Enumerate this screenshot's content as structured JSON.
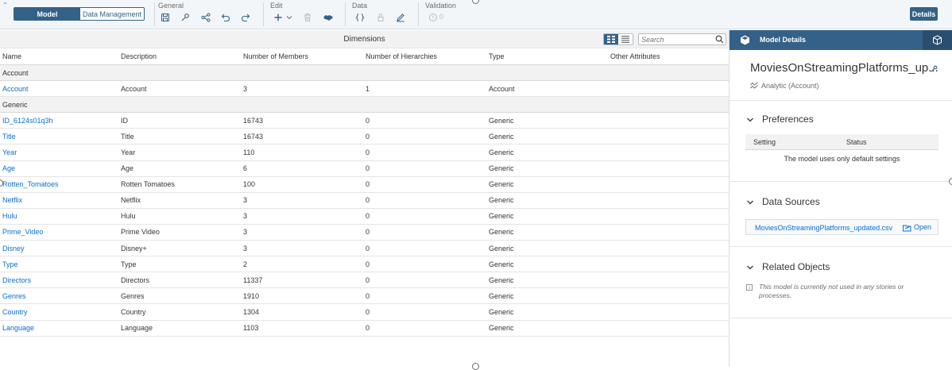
{
  "toolbar": {
    "mode_tabs": [
      "Model",
      "Data Management"
    ],
    "groups": {
      "general": "General",
      "edit": "Edit",
      "data": "Data",
      "validation": "Validation"
    },
    "validation_count": "0",
    "details_label": "Details",
    "icons": {
      "general": [
        "save-icon",
        "wrench-icon",
        "share-icon",
        "undo-icon",
        "redo-icon"
      ],
      "edit": [
        "add-icon",
        "delete-icon",
        "handshake-icon"
      ],
      "data": [
        "formula-icon",
        "lock-icon",
        "pencil-icon"
      ],
      "validation": [
        "info-circle-icon"
      ]
    }
  },
  "dimensions": {
    "title": "Dimensions",
    "search_placeholder": "Search",
    "columns": [
      "Name",
      "Description",
      "Number of Members",
      "Number of Hierarchies",
      "Type",
      "Other Attributes"
    ],
    "groups": [
      {
        "label": "Account",
        "rows": [
          {
            "name": "Account",
            "description": "Account",
            "members": "3",
            "hierarchies": "1",
            "type": "Account"
          }
        ]
      },
      {
        "label": "Generic",
        "rows": [
          {
            "name": "ID_6124s01q3h",
            "description": "ID",
            "members": "16743",
            "hierarchies": "0",
            "type": "Generic"
          },
          {
            "name": "Title",
            "description": "Title",
            "members": "16743",
            "hierarchies": "0",
            "type": "Generic"
          },
          {
            "name": "Year",
            "description": "Year",
            "members": "110",
            "hierarchies": "0",
            "type": "Generic"
          },
          {
            "name": "Age",
            "description": "Age",
            "members": "6",
            "hierarchies": "0",
            "type": "Generic"
          },
          {
            "name": "Rotten_Tomatoes",
            "description": "Rotten Tomatoes",
            "members": "100",
            "hierarchies": "0",
            "type": "Generic"
          },
          {
            "name": "Netflix",
            "description": "Netflix",
            "members": "3",
            "hierarchies": "0",
            "type": "Generic"
          },
          {
            "name": "Hulu",
            "description": "Hulu",
            "members": "3",
            "hierarchies": "0",
            "type": "Generic"
          },
          {
            "name": "Prime_Video",
            "description": "Prime Video",
            "members": "3",
            "hierarchies": "0",
            "type": "Generic"
          },
          {
            "name": "Disney",
            "description": "Disney+",
            "members": "3",
            "hierarchies": "0",
            "type": "Generic"
          },
          {
            "name": "Type",
            "description": "Type",
            "members": "2",
            "hierarchies": "0",
            "type": "Generic"
          },
          {
            "name": "Directors",
            "description": "Directors",
            "members": "11337",
            "hierarchies": "0",
            "type": "Generic"
          },
          {
            "name": "Genres",
            "description": "Genres",
            "members": "1910",
            "hierarchies": "0",
            "type": "Generic"
          },
          {
            "name": "Country",
            "description": "Country",
            "members": "1304",
            "hierarchies": "0",
            "type": "Generic"
          },
          {
            "name": "Language",
            "description": "Language",
            "members": "1103",
            "hierarchies": "0",
            "type": "Generic"
          }
        ]
      }
    ]
  },
  "panel": {
    "title": "Model Details",
    "model_name": "MoviesOnStreamingPlatforms_up...",
    "model_type": "Analytic (Account)",
    "preferences": {
      "title": "Preferences",
      "columns": [
        "Setting",
        "Status"
      ],
      "empty_text": "The model uses only default settings"
    },
    "data_sources": {
      "title": "Data Sources",
      "file": "MoviesOnStreamingPlatforms_updated.csv",
      "open_label": "Open"
    },
    "related_objects": {
      "title": "Related Objects",
      "text": "This model is currently not used in any stories or processes."
    }
  },
  "colors": {
    "accent": "#346187",
    "link": "#0a6ed1",
    "toolbar_bg": "#f3f6f9"
  }
}
